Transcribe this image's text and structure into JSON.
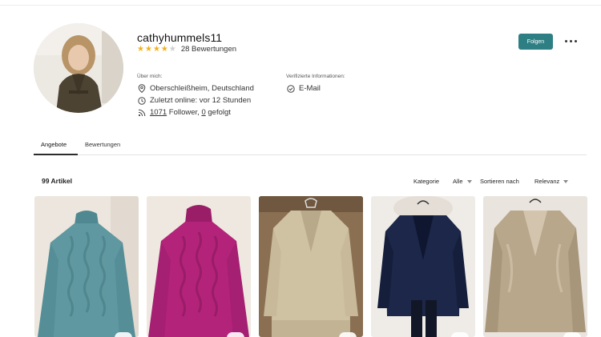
{
  "profile": {
    "username": "cathyhummels11",
    "rating_stars": 4,
    "rating_max": 5,
    "review_count": "28 Bewertungen"
  },
  "about": {
    "heading": "Über mich:",
    "location": "Oberschleißheim, Deutschland",
    "last_online": "Zuletzt online: vor 12 Stunden",
    "followers_count": "1071",
    "followers_label": " Follower, ",
    "following_count": "0",
    "following_label": " gefolgt"
  },
  "verified": {
    "heading": "Verifizierte Informationen:",
    "email": "E-Mail"
  },
  "actions": {
    "follow_label": "Folgen"
  },
  "tabs": [
    {
      "label": "Angebote",
      "active": true
    },
    {
      "label": "Bewertungen",
      "active": false
    }
  ],
  "listing": {
    "count": "99 Artikel",
    "category_label": "Kategorie",
    "category_value": "Alle",
    "sort_label": "Sortieren nach",
    "sort_value": "Relevanz"
  },
  "items": [
    {
      "name": "teal-cable-knit-sweater",
      "color": "#5f98a0"
    },
    {
      "name": "magenta-cable-knit-sweater",
      "color": "#b3237a"
    },
    {
      "name": "beige-knit-cardigan",
      "color": "#cfc2a2"
    },
    {
      "name": "navy-velvet-blazer",
      "color": "#1c2749"
    },
    {
      "name": "gold-metallic-blazer",
      "color": "#b9a78c"
    }
  ],
  "colors": {
    "accent": "#2d7f83",
    "star": "#f2b01e"
  }
}
